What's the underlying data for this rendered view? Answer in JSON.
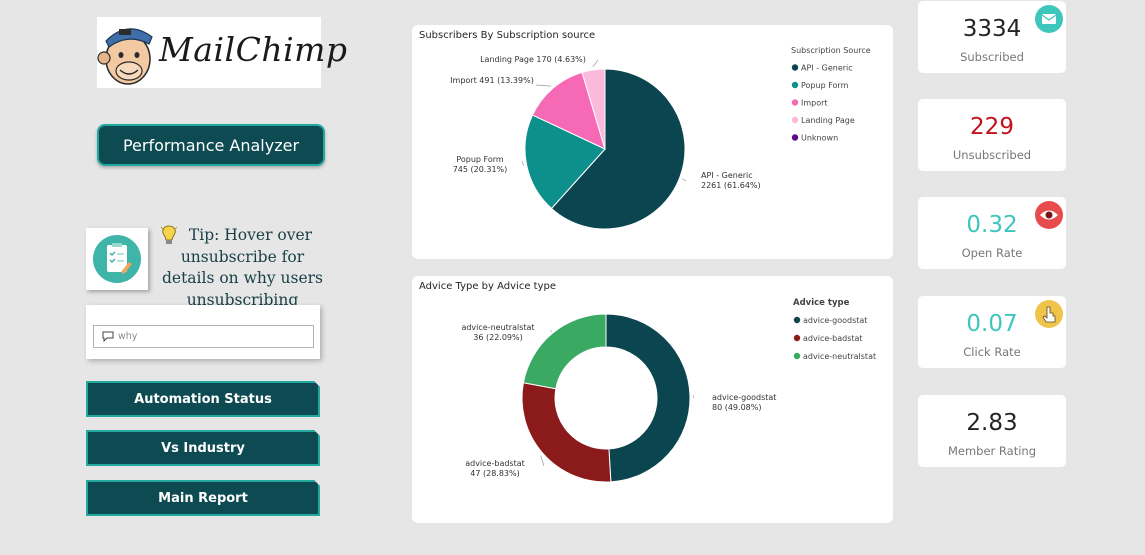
{
  "logo": {
    "text": "MailChimp",
    "icon": "mailchimp-monkey-icon"
  },
  "sidebar": {
    "performance_button": "Performance Analyzer",
    "tip": {
      "icon": "checklist-icon",
      "bulb_icon": "lightbulb-icon",
      "text": "Tip: Hover over unsubscribe for details on why users unsubscribing"
    },
    "why_input": {
      "placeholder": "why",
      "icon": "comment-icon"
    },
    "nav": [
      {
        "label": "Automation Status"
      },
      {
        "label": "Vs Industry"
      },
      {
        "label": "Main Report"
      }
    ]
  },
  "kpis": [
    {
      "value": "3334",
      "label": "Subscribed",
      "color": "#252423",
      "icon": "envelope-icon",
      "icon_bg": "#3ec6bd"
    },
    {
      "value": "229",
      "label": "Unsubscribed",
      "color": "#c0121d",
      "icon": "",
      "icon_bg": ""
    },
    {
      "value": "0.32",
      "label": "Open Rate",
      "color": "#3ec6bd",
      "icon": "eye-icon",
      "icon_bg": "#e84b4b"
    },
    {
      "value": "0.07",
      "label": "Click Rate",
      "color": "#3ec6bd",
      "icon": "hand-pointer-icon",
      "icon_bg": "#f0c44a"
    },
    {
      "value": "2.83",
      "label": "Member Rating",
      "color": "#252423",
      "icon": "",
      "icon_bg": ""
    }
  ],
  "chart_data": [
    {
      "type": "pie",
      "title": "Subscribers By Subscription source",
      "legend_title": "Subscription Source",
      "legend_position": "top-right",
      "categories": [
        "API - Generic",
        "Popup Form",
        "Import",
        "Landing Page",
        "Unknown"
      ],
      "values": [
        2261,
        745,
        491,
        170,
        0
      ],
      "percents": [
        "61.64%",
        "20.31%",
        "13.39%",
        "4.63%",
        ""
      ],
      "colors": [
        "#0b4650",
        "#0d8f8c",
        "#f569b5",
        "#fbbadc",
        "#5a0b8c"
      ],
      "labels": [
        [
          "API - Generic",
          "2261 (61.64%)"
        ],
        [
          "Popup Form",
          "745 (20.31%)"
        ],
        [
          "Import 491 (13.39%)"
        ],
        [
          "Landing Page 170 (4.63%)"
        ],
        []
      ]
    },
    {
      "type": "pie",
      "donut": true,
      "title": "Advice Type by Advice type",
      "legend_title": "Advice type",
      "legend_position": "top-right",
      "categories": [
        "advice-goodstat",
        "advice-badstat",
        "advice-neutralstat"
      ],
      "values": [
        80,
        47,
        36
      ],
      "percents": [
        "49.08%",
        "28.83%",
        "22.09%"
      ],
      "colors": [
        "#0b4650",
        "#8b1a1a",
        "#3aa961"
      ],
      "labels": [
        [
          "advice-goodstat",
          "80 (49.08%)"
        ],
        [
          "advice-badstat",
          "47 (28.83%)"
        ],
        [
          "advice-neutralstat",
          "36 (22.09%)"
        ]
      ]
    }
  ]
}
